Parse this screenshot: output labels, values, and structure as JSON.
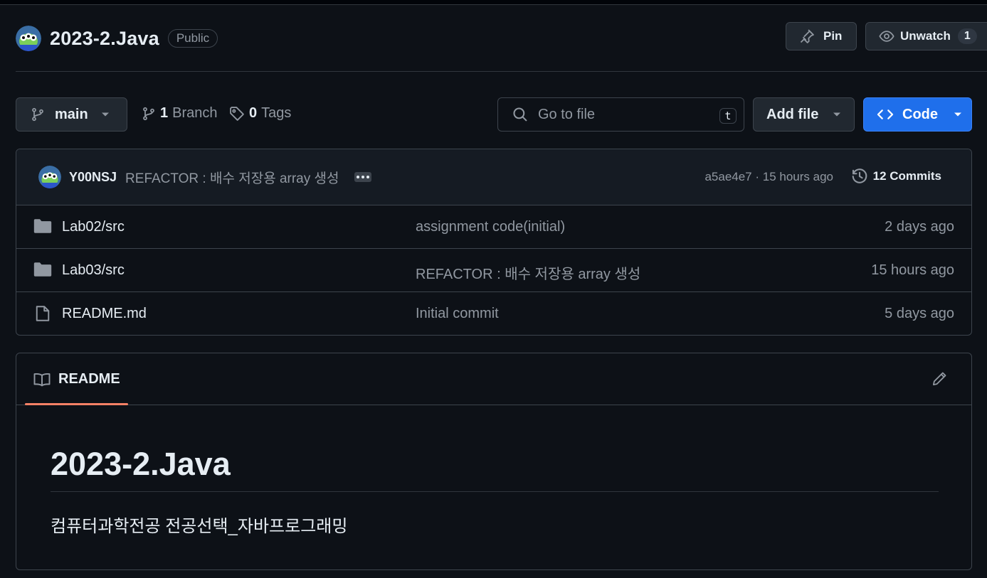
{
  "colors": {
    "background": "#0d1117",
    "border": "#3d444d",
    "text": "#e6edf3",
    "muted": "#9198a1",
    "primary_button": "#1f6feb",
    "tab_underline": "#f78166"
  },
  "repo": {
    "name": "2023-2.Java",
    "visibility": "Public"
  },
  "header_actions": {
    "pin_label": "Pin",
    "unwatch_label": "Unwatch",
    "watch_count": "1"
  },
  "toolbar": {
    "branch": "main",
    "branches_count": "1",
    "branches_label": "Branch",
    "tags_count": "0",
    "tags_label": "Tags",
    "search_placeholder": "Go to file",
    "search_shortcut": "t",
    "add_file_label": "Add file",
    "code_label": "Code"
  },
  "latest_commit": {
    "author": "Y00NSJ",
    "message": "REFACTOR : 배수 저장용 array 생성",
    "meta": "a5ae4e7 · 15 hours ago",
    "commits_label": "12 Commits"
  },
  "files": [
    {
      "type": "folder",
      "icon": "folder-icon",
      "name": "Lab02/src",
      "commit": "assignment code(initial)",
      "time": "2 days ago"
    },
    {
      "type": "folder",
      "icon": "folder-icon",
      "name": "Lab03/src",
      "commit": "REFACTOR : 배수 저장용 array 생성",
      "time": "15 hours ago"
    },
    {
      "type": "file",
      "icon": "file-icon",
      "name": "README.md",
      "commit": "Initial commit",
      "time": "5 days ago"
    }
  ],
  "readme": {
    "tab_label": "README",
    "heading": "2023-2.Java",
    "body": "컴퓨터과학전공 전공선택_자바프로그래밍"
  }
}
